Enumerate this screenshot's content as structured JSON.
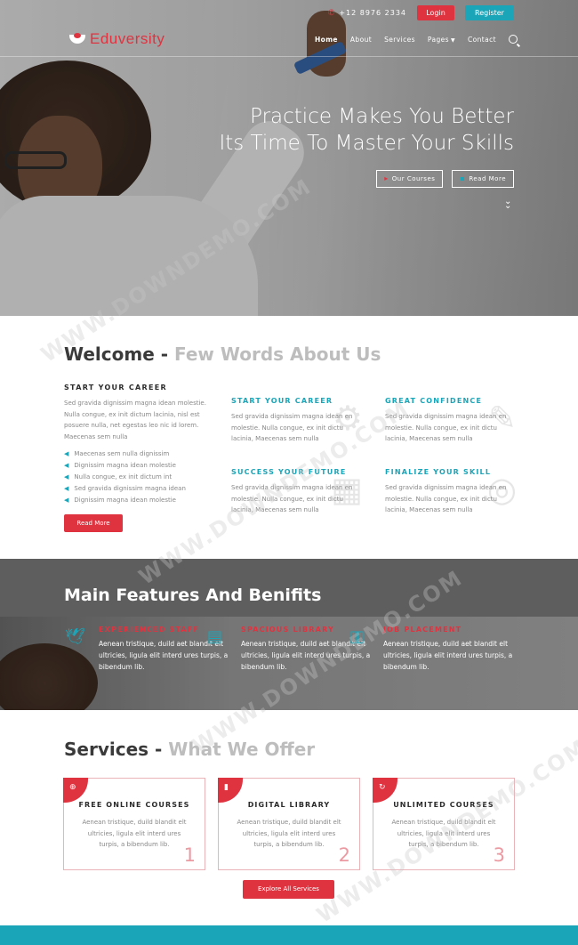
{
  "topbar": {
    "phone": "+12 8976 2334",
    "login": "Login",
    "register": "Register"
  },
  "brand": {
    "name": "Eduversity"
  },
  "nav": {
    "items": [
      "Home",
      "About",
      "Services",
      "Pages",
      "Contact"
    ]
  },
  "hero": {
    "title_line1": "Practice Makes You Better",
    "title_line2": "Its Time To Master Your Skills",
    "btn_courses": "Our Courses",
    "btn_readmore": "Read More"
  },
  "welcome": {
    "title": "Welcome",
    "title_sep": " - ",
    "title_muted": "Few Words About Us",
    "career_heading": "START YOUR CAREER",
    "career_text": "Sed gravida dignissim magna idean molestie. Nulla congue, ex init dictum lacinia, nisl est posuere nulla, net egestas leo nic id lorem. Maecenas sem nulla",
    "career_list": [
      "Maecenas sem nulla dignissim",
      "Dignissim magna idean molestie",
      "Nulla congue, ex init dictum int",
      "Sed gravida dignissim magna idean",
      "Dignissim magna idean molestie"
    ],
    "readmore": "Read More",
    "features": [
      {
        "title": "START YOUR CAREER",
        "text": "Sed gravida dignissim magna idean en molestie. Nulla congue, ex init dictu lacinia, Maecenas sem nulla"
      },
      {
        "title": "GREAT CONFIDENCE",
        "text": "Sed gravida dignissim magna idean en molestie. Nulla congue, ex init dictu lacinia, Maecenas sem nulla"
      },
      {
        "title": "SUCCESS YOUR FUTURE",
        "text": "Sed gravida dignissim magna idean en molestie. Nulla congue, ex init dictu lacinia, Maecenas sem nulla"
      },
      {
        "title": "FINALIZE YOUR SKILL",
        "text": "Sed gravida dignissim magna idean en molestie. Nulla congue, ex init dictu lacinia, Maecenas sem nulla"
      }
    ]
  },
  "main_features": {
    "title": "Main Features And Benifits",
    "items": [
      {
        "title": "EXPERIENCED STAFF",
        "text": "Aenean tristique, duild aet blandit elt ultricies, ligula elit interd ures turpis, a bibendum lib.",
        "icon": "bird-icon"
      },
      {
        "title": "SPACIOUS LIBRARY",
        "text": "Aenean tristique, duild aet blandit elt ultricies, ligula elit interd ures turpis, a bibendum lib.",
        "icon": "book-icon"
      },
      {
        "title": "JOB PLACEMENT",
        "text": "Aenean tristique, duild aet blandit elt ultricies, ligula elit interd ures turpis, a bibendum lib.",
        "icon": "building-icon"
      }
    ]
  },
  "services": {
    "title": "Services",
    "title_sep": " - ",
    "title_muted": "What We Offer",
    "cards": [
      {
        "title": "FREE ONLINE COURSES",
        "text": "Aenean tristique, duild blandit elt ultricies, ligula elit interd ures turpis, a bibendum lib.",
        "num": "1"
      },
      {
        "title": "DIGITAL LIBRARY",
        "text": "Aenean tristique, duild blandit elt ultricies, ligula elit interd ures turpis, a bibendum lib.",
        "num": "2"
      },
      {
        "title": "UNLIMITED COURSES",
        "text": "Aenean tristique, duild blandit elt ultricies, ligula elit interd ures turpis, a bibendum lib.",
        "num": "3"
      }
    ],
    "explore": "Explore All Services"
  },
  "watermark": "WWW.DOWNDEMO.COM",
  "colors": {
    "accent": "#e03340",
    "teal": "#1ba5b8"
  }
}
